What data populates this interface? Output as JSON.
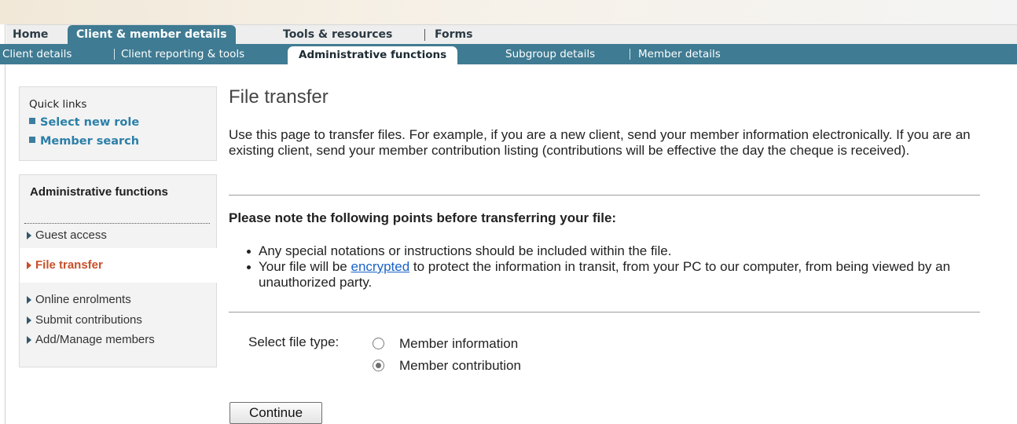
{
  "main_nav": {
    "home": "Home",
    "client_member_details": "Client & member details",
    "tools_resources": "Tools & resources",
    "forms": "Forms"
  },
  "sub_nav": {
    "client_details": "Client details",
    "client_reporting_tools": "Client reporting & tools",
    "administrative_functions": "Administrative functions",
    "subgroup_details": "Subgroup details",
    "member_details": "Member details"
  },
  "quick_links": {
    "title": "Quick links",
    "items": [
      "Select new role",
      "Member search"
    ]
  },
  "sidebar": {
    "heading": "Administrative functions",
    "items": [
      {
        "label": "Guest access",
        "active": false
      },
      {
        "label": "File transfer",
        "active": true
      },
      {
        "label": "Online enrolments",
        "active": false
      },
      {
        "label": "Submit contributions",
        "active": false
      },
      {
        "label": "Add/Manage members",
        "active": false
      }
    ]
  },
  "content": {
    "title": "File transfer",
    "intro": "Use this page to transfer files. For example, if you are a new client, send your member information electronically. If you are an existing client, send your member contribution listing (contributions will be effective the day the cheque is received).",
    "note_heading": "Please note the following points before transferring your file:",
    "bullet1": "Any special notations or instructions should be included within the file.",
    "bullet2_before": "Your file will be ",
    "bullet2_link": "encrypted",
    "bullet2_after": " to protect the information in transit, from your PC to our computer, from being viewed by an unauthorized party.",
    "file_type_label": "Select file type:",
    "options": [
      {
        "label": "Member information",
        "checked": false
      },
      {
        "label": "Member contribution",
        "checked": true
      }
    ],
    "continue_label": "Continue"
  },
  "colors": {
    "nav_teal": "#3f7b92",
    "link_blue": "#2b7fa8",
    "active_orange": "#c7502a"
  }
}
